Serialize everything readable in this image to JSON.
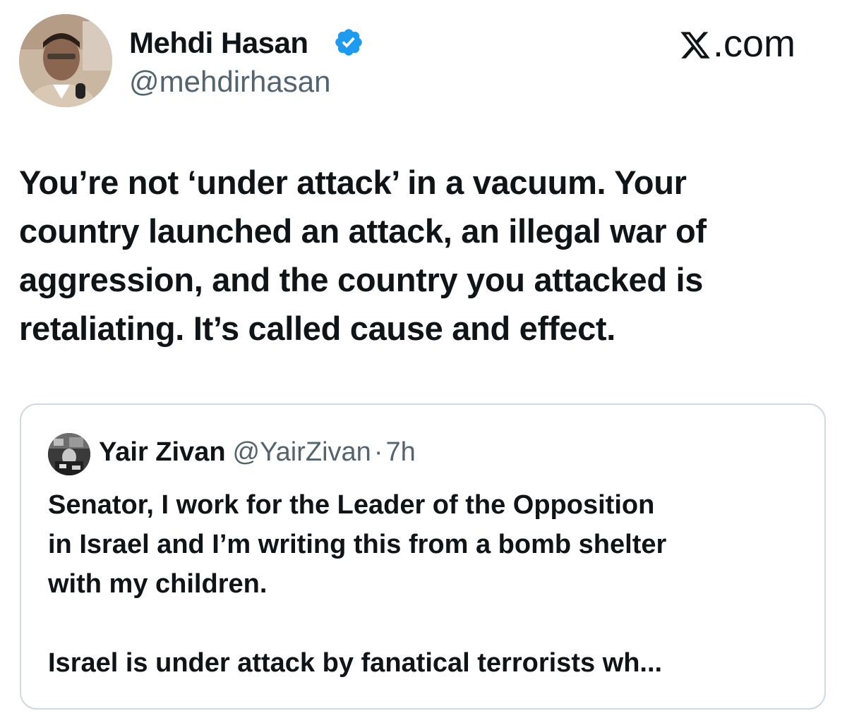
{
  "tweet": {
    "author": {
      "display_name": "Mehdi Hasan",
      "handle": "@mehdirhasan",
      "verified": true,
      "verified_color": "#1d9bf0",
      "avatar_icon": "profile-photo"
    },
    "brand": {
      "label": ".com",
      "icon": "x-logo-icon"
    },
    "body_lines": [
      "You’re not ‘under attack’ in a vacuum. Your",
      "country launched an attack, an illegal war of",
      "aggression, and the country you attacked is",
      "retaliating. It’s called cause and effect."
    ]
  },
  "quoted_tweet": {
    "author": {
      "display_name": "Yair Zivan",
      "handle": "@YairZivan",
      "separator": "·",
      "time": "7h",
      "avatar_icon": "profile-photo"
    },
    "body_lines": [
      "Senator, I work for the Leader of the Opposition",
      "in Israel and I’m writing this from a bomb shelter",
      "with my children.",
      "",
      "Israel is under attack by fanatical terrorists wh..."
    ]
  },
  "colors": {
    "text_primary": "#0f1419",
    "text_secondary": "#536471",
    "border": "#cfd9de"
  }
}
